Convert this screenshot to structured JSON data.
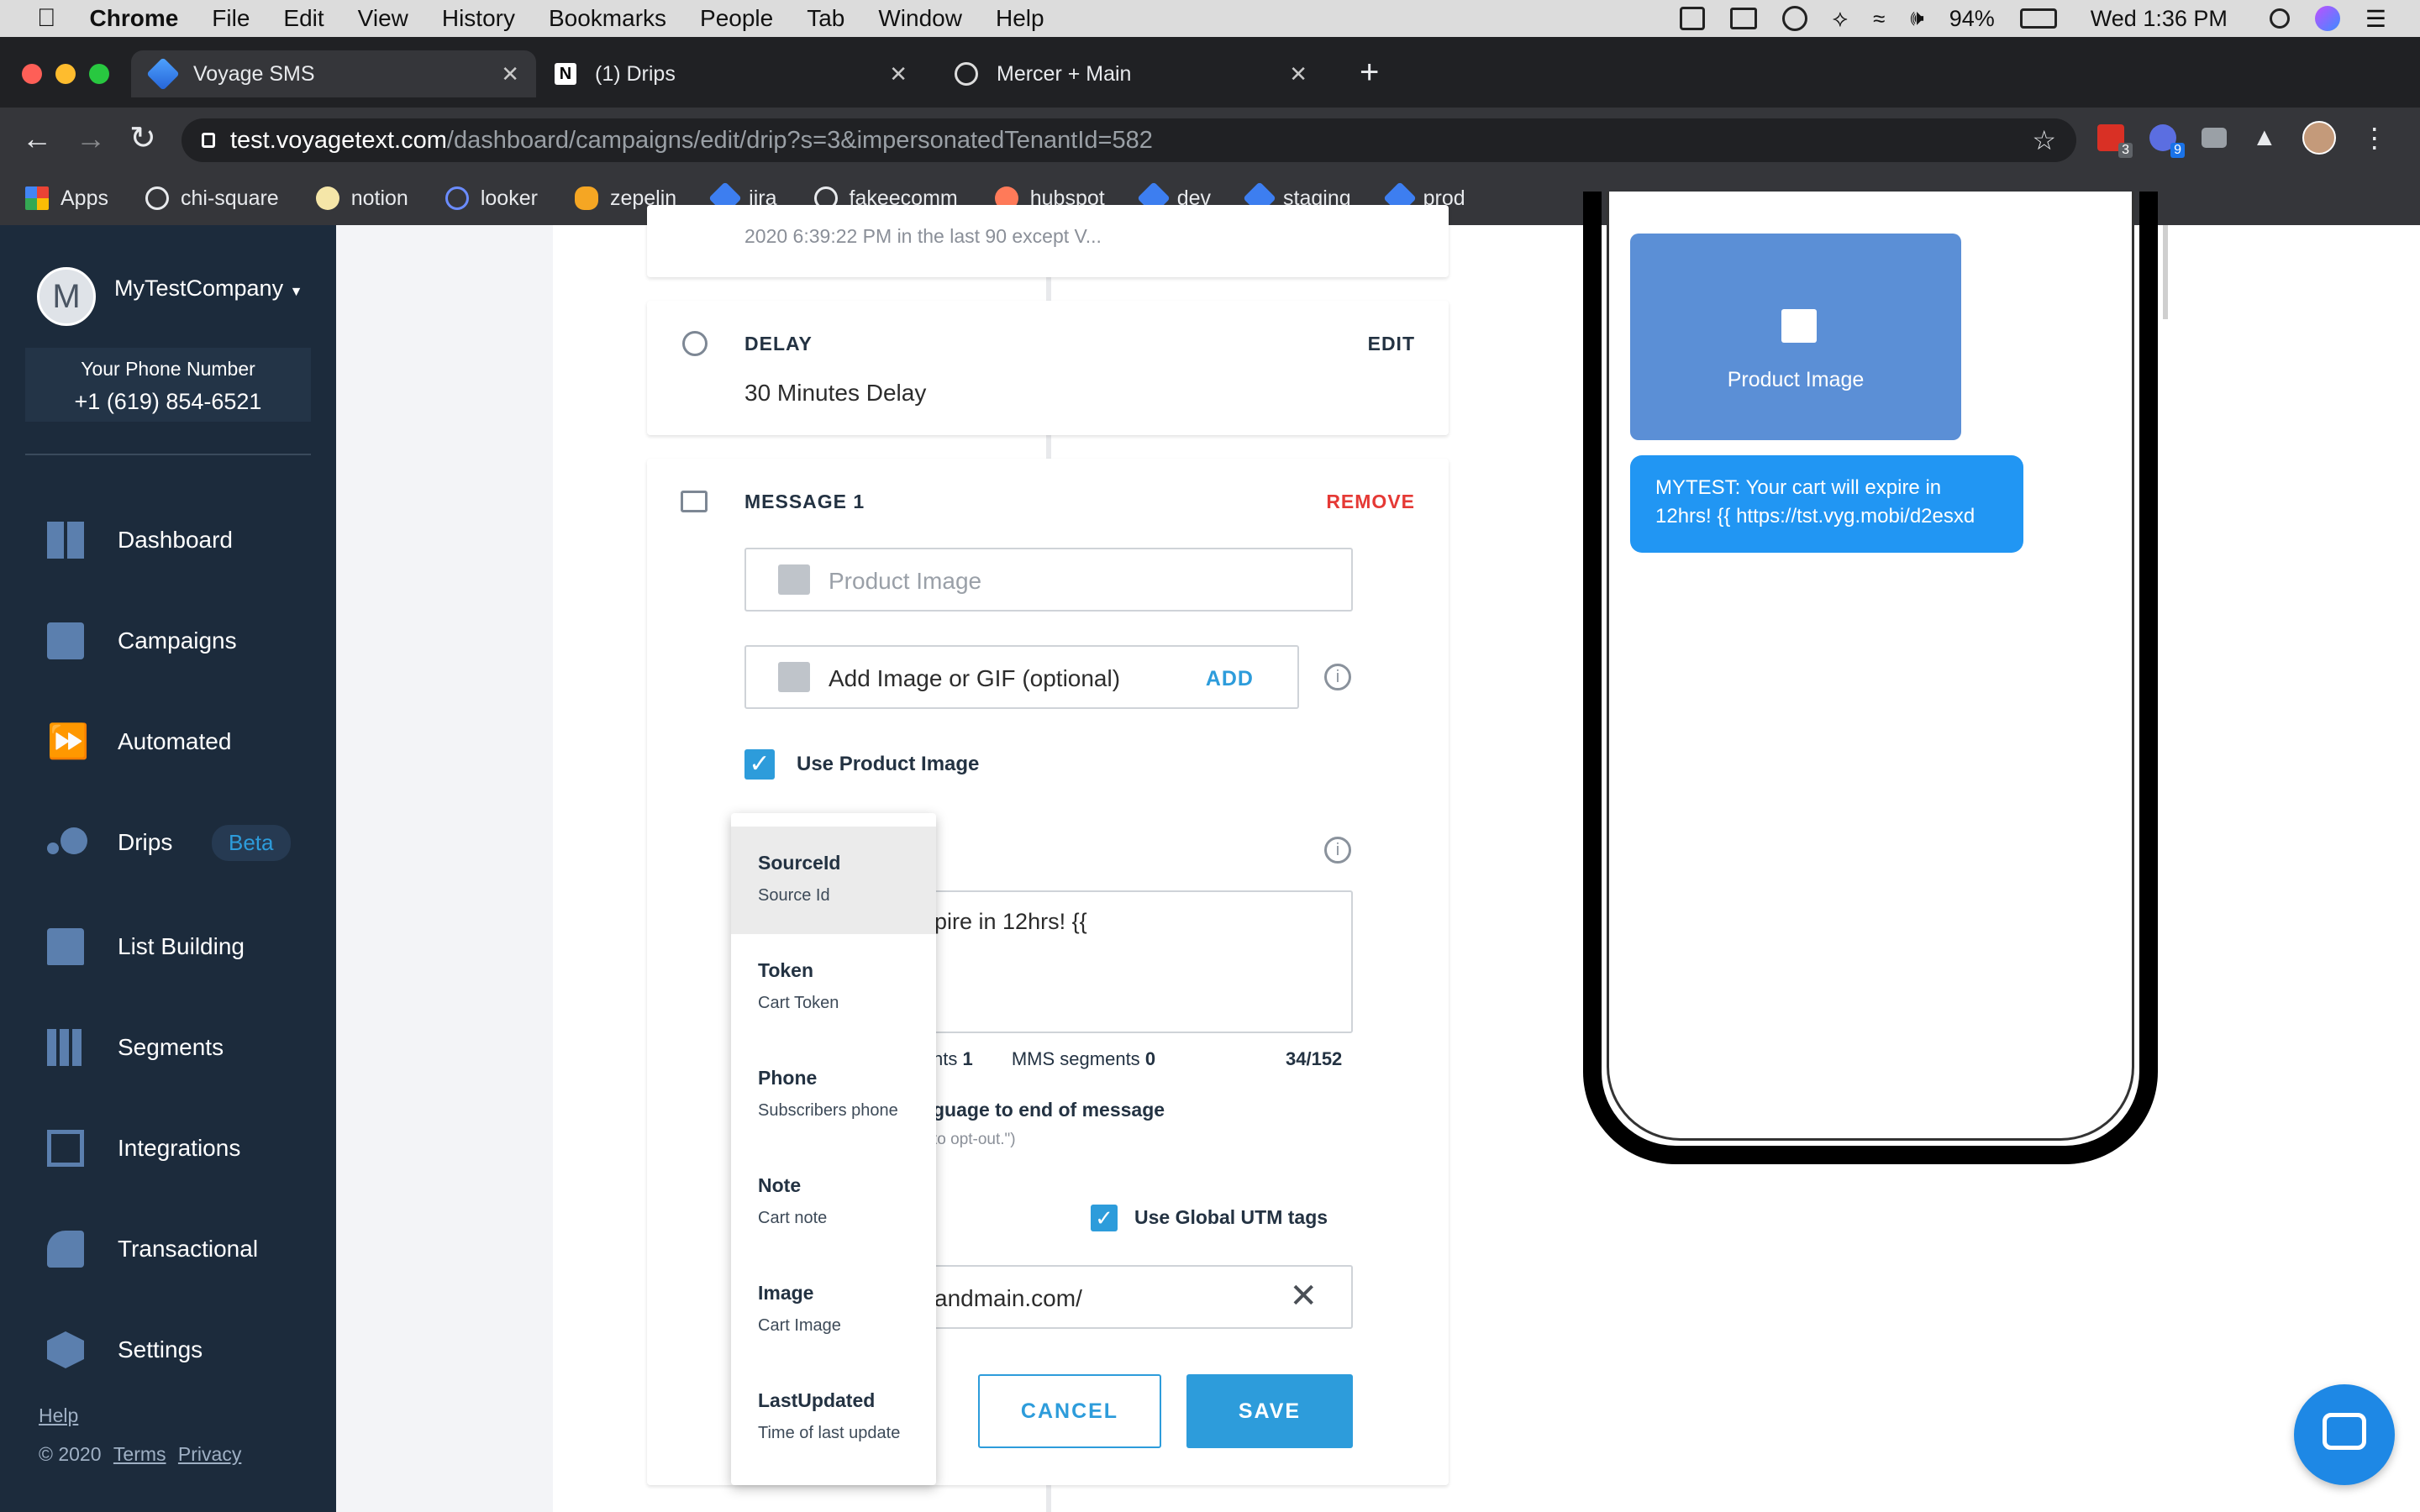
{
  "mac_menu": {
    "app": "Chrome",
    "items": [
      "File",
      "Edit",
      "View",
      "History",
      "Bookmarks",
      "People",
      "Tab",
      "Window",
      "Help"
    ],
    "battery": "94%",
    "clock": "Wed 1:36 PM"
  },
  "browser": {
    "tabs": [
      {
        "title": "Voyage SMS"
      },
      {
        "title": "(1) Drips"
      },
      {
        "title": "Mercer + Main"
      }
    ],
    "url_host": "test.voyagetext.com",
    "url_path": "/dashboard/campaigns/edit/drip?s=3&impersonatedTenantId=582",
    "ext_badges": [
      "3",
      "9"
    ],
    "bookmarks": [
      "Apps",
      "chi-square",
      "notion",
      "looker",
      "zepelin",
      "jira",
      "fakeecomm",
      "hubspot",
      "dev",
      "staging",
      "prod"
    ]
  },
  "sidebar": {
    "avatar_letter": "M",
    "company": "MyTestCompany",
    "phone_label": "Your Phone Number",
    "phone_number": "+1 (619) 854-6521",
    "nav": [
      "Dashboard",
      "Campaigns",
      "Automated",
      "Drips",
      "List Building",
      "Segments",
      "Integrations",
      "Transactional",
      "Settings"
    ],
    "drips_badge": "Beta",
    "help": "Help",
    "copyright": "© 2020",
    "terms": "Terms",
    "privacy": "Privacy"
  },
  "editor": {
    "top_card_text": "2020 6:39:22 PM in the last 90 except V...",
    "delay": {
      "title": "DELAY",
      "edit": "EDIT",
      "value": "30 Minutes Delay"
    },
    "message": {
      "title": "MESSAGE 1",
      "remove": "REMOVE",
      "product_image_placeholder": "Product Image",
      "add_image_label": "Add Image or GIF (optional)",
      "add_button": "ADD",
      "use_product_image": "Use Product Image",
      "message_text_visible": "pire in 12hrs! {{",
      "segments_partial": "nts",
      "sms_segments_value": "1",
      "mms_label": "MMS segments",
      "mms_value": "0",
      "char_count": "34/152",
      "optout_partial": "guage to end of message",
      "optout_hint_partial": "to opt-out.\")",
      "use_utm": "Use Global UTM tags",
      "url_value_partial": "andmain.com/",
      "cancel": "CANCEL",
      "save": "SAVE"
    }
  },
  "dropdown": [
    {
      "title": "SourceId",
      "sub": "Source Id"
    },
    {
      "title": "Token",
      "sub": "Cart Token"
    },
    {
      "title": "Phone",
      "sub": "Subscribers phone"
    },
    {
      "title": "Note",
      "sub": "Cart note"
    },
    {
      "title": "Image",
      "sub": "Cart Image"
    },
    {
      "title": "LastUpdated",
      "sub": "Time of last update"
    }
  ],
  "phone_preview": {
    "image_label": "Product Image",
    "bubble_text": "MYTEST: Your cart will expire in 12hrs! {{ https://tst.vyg.mobi/d2esxd"
  },
  "colors": {
    "sidebar": "#1c2b3c",
    "accent": "#2d9cdb",
    "remove": "#e53935",
    "bubble": "#2196f3",
    "preview_image": "#5b8fd6"
  }
}
